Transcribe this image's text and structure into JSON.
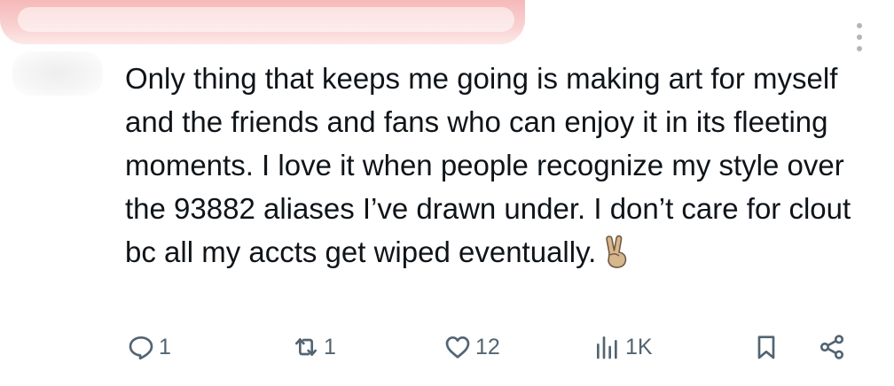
{
  "tweet": {
    "text": "Only thing that keeps me going is making art for myself and the friends and fans who can enjoy it in its fleeting moments. I love it when people recognize my style over the 93882 aliases I’ve drawn under. I don’t care for clout bc all my accts get wiped eventually.",
    "emoji": "victory-hand-emoji"
  },
  "actions": {
    "reply_count": "1",
    "repost_count": "1",
    "like_count": "12",
    "view_count": "1K"
  },
  "colors": {
    "text": "#0f1419",
    "icon": "#536471",
    "redaction": "#f6b9b9"
  }
}
